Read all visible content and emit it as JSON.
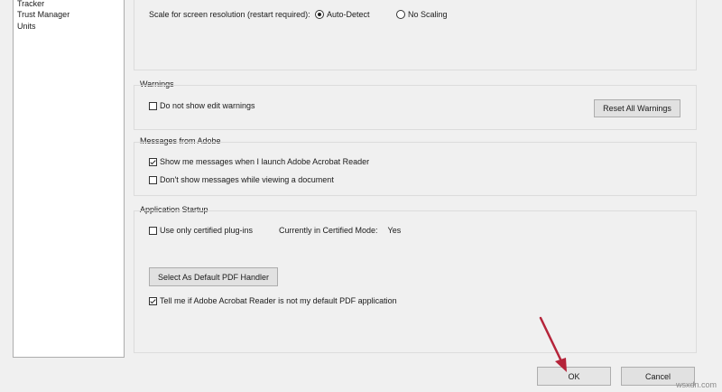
{
  "sidebar": {
    "items": [
      {
        "label": "Tracker"
      },
      {
        "label": "Trust Manager"
      },
      {
        "label": "Units"
      }
    ]
  },
  "scale": {
    "label": "Scale for screen resolution (restart required):",
    "options": [
      {
        "label": "Auto-Detect",
        "selected": true
      },
      {
        "label": "No Scaling",
        "selected": false
      }
    ]
  },
  "warnings": {
    "title": "Warnings",
    "do_not_show_edit": {
      "label": "Do not show edit warnings",
      "checked": false
    },
    "reset_button": "Reset All Warnings"
  },
  "messages": {
    "title": "Messages from Adobe",
    "show_on_launch": {
      "label": "Show me messages when I launch Adobe Acrobat Reader",
      "checked": true
    },
    "dont_show_viewing": {
      "label": "Don't show messages while viewing a document",
      "checked": false
    }
  },
  "startup": {
    "title": "Application Startup",
    "certified_plugins": {
      "label": "Use only certified plug-ins",
      "checked": false
    },
    "certified_mode_label": "Currently in Certified Mode:",
    "certified_mode_value": "Yes",
    "default_handler_button": "Select As Default PDF Handler",
    "tell_me_default": {
      "label": "Tell me if Adobe Acrobat Reader is not my default PDF application",
      "checked": true
    }
  },
  "footer": {
    "ok_label": "OK",
    "cancel_label": "Cancel"
  },
  "watermark": "wsxdn.com",
  "annotation": {
    "arrow_color": "#b5243a"
  }
}
